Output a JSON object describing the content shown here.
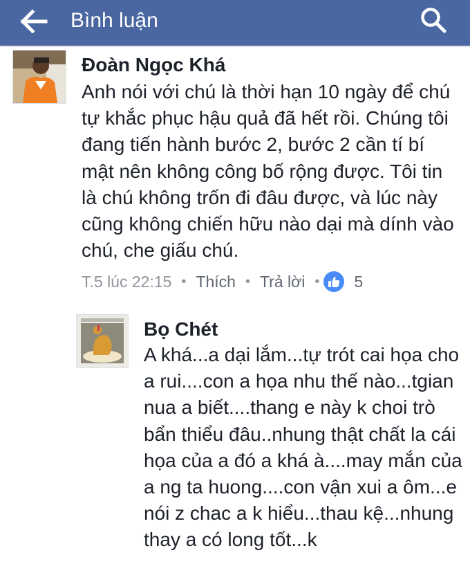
{
  "header": {
    "title": "Bình luận"
  },
  "comments": [
    {
      "author": "Đoàn Ngọc Khá",
      "text": "Anh nói với chú là thời hạn 10 ngày để chú tự khắc phục hậu quả đã hết rồi. Chúng tôi đang tiến hành bước 2, bước 2 cần tí bí mật nên không công bố rộng được. Tôi tin là chú không trốn đi đâu được, và lúc này cũng không chiến hữu nào dại mà dính vào chú, che giấu chú.",
      "time": "T.5 lúc 22:15",
      "like_label": "Thích",
      "reply_label": "Trả lời",
      "reaction_count": "5"
    },
    {
      "author": "Bọ Chét",
      "text": "A khá...a dại lắm...tự trót cai họa cho a rui....con a họa nhu thế nào...tgian nua a biết....thang e này k choi trò bẩn thiểu đâu..nhung thật chất la cái họa của a đó a khá à....may mắn của a ng ta huong....con vận xui a ôm...e nói z chac a k hiểu...thau kệ...nhung thay a có long tốt...k"
    }
  ],
  "icons": {
    "back": "arrow-left-icon",
    "search": "search-icon",
    "reaction": "like-thumb-icon"
  },
  "colors": {
    "header_bg": "#4b67a1",
    "text": "#1d2129",
    "meta": "#90949c",
    "like_badge": "#4a8cf7"
  }
}
